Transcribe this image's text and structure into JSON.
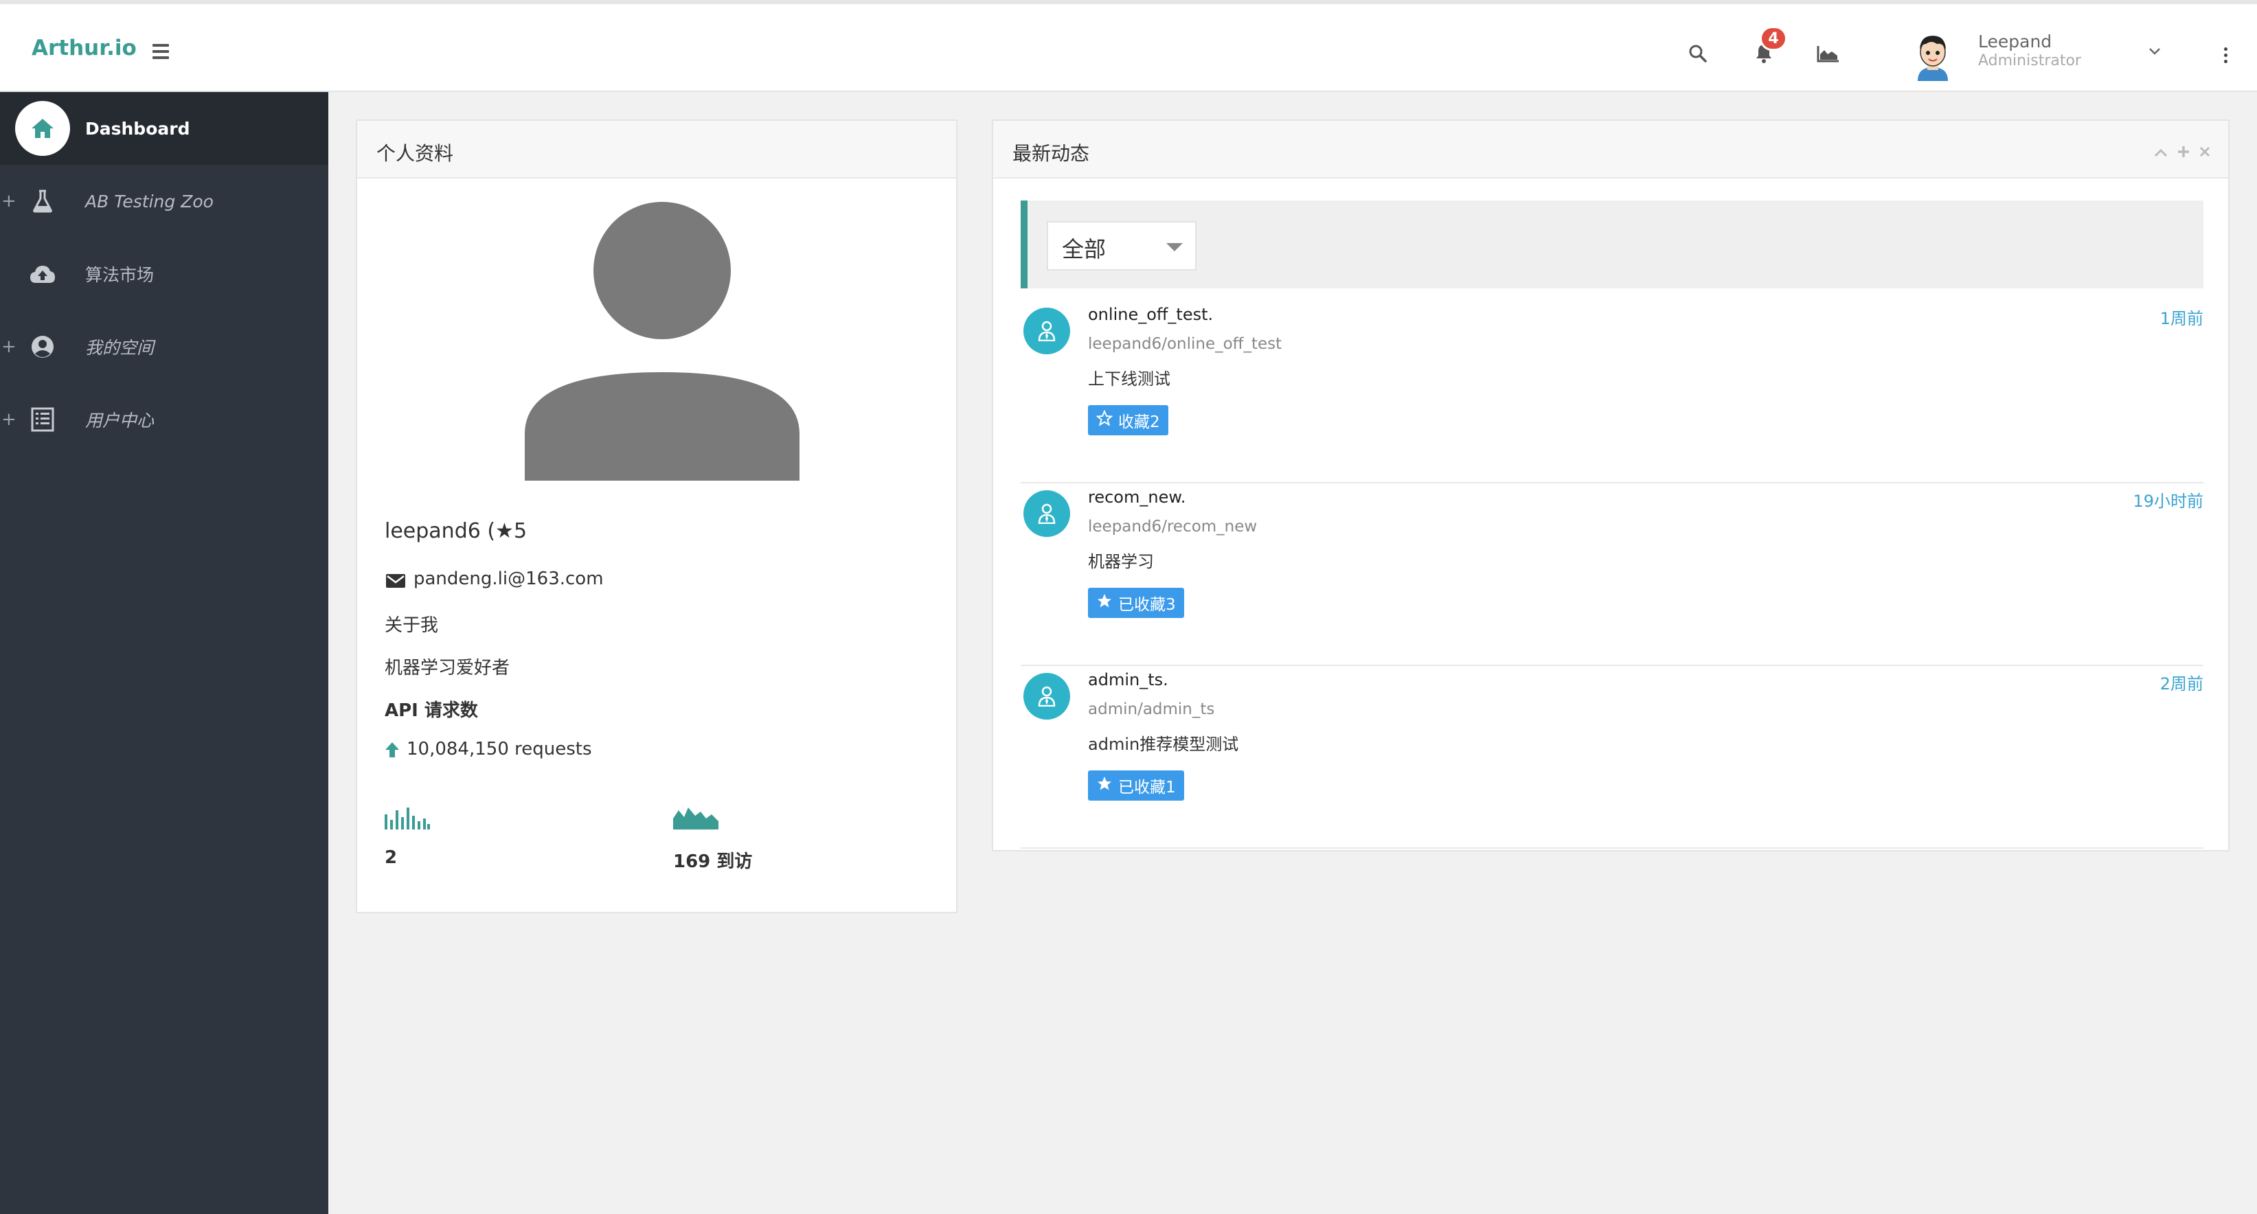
{
  "header": {
    "brand": "Arthur.io",
    "notification_count": "4",
    "user_name": "Leepand",
    "user_role": "Administrator"
  },
  "sidebar": {
    "items": [
      {
        "label": "Dashboard",
        "icon": "home-icon",
        "active": true
      },
      {
        "label": "AB Testing Zoo",
        "icon": "flask-icon",
        "expandable": true
      },
      {
        "label": "算法市场",
        "icon": "cloud-upload-icon"
      },
      {
        "label": "我的空间",
        "icon": "user-circle-icon",
        "expandable": true
      },
      {
        "label": "用户中心",
        "icon": "list-icon",
        "expandable": true
      }
    ]
  },
  "profile": {
    "title": "个人资料",
    "name": "leepand6 (★5",
    "email": "pandeng.li@163.com",
    "about_heading": "关于我",
    "about": "机器学习爱好者",
    "api_heading": "API 请求数",
    "requests": "10,084,150 requests",
    "stat1": "2",
    "stat2": "169 到访"
  },
  "activity": {
    "title": "最新动态",
    "filter": "全部",
    "items": [
      {
        "title": "online_off_test.",
        "path": "leepand6/online_off_test",
        "desc": "上下线测试",
        "time": "1周前",
        "fav": "收藏2",
        "fav_filled": false
      },
      {
        "title": "recom_new.",
        "path": "leepand6/recom_new",
        "desc": "机器学习",
        "time": "19小时前",
        "fav": "已收藏3",
        "fav_filled": true
      },
      {
        "title": "admin_ts.",
        "path": "admin/admin_ts",
        "desc": "admin推荐模型测试",
        "time": "2周前",
        "fav": "已收藏1",
        "fav_filled": true
      }
    ]
  },
  "colors": {
    "accent": "#3a9c93",
    "sidebar": "#2f353f",
    "badge": "#e04b3f",
    "button": "#3b9bea",
    "feed_avatar": "#2fb3c8"
  }
}
